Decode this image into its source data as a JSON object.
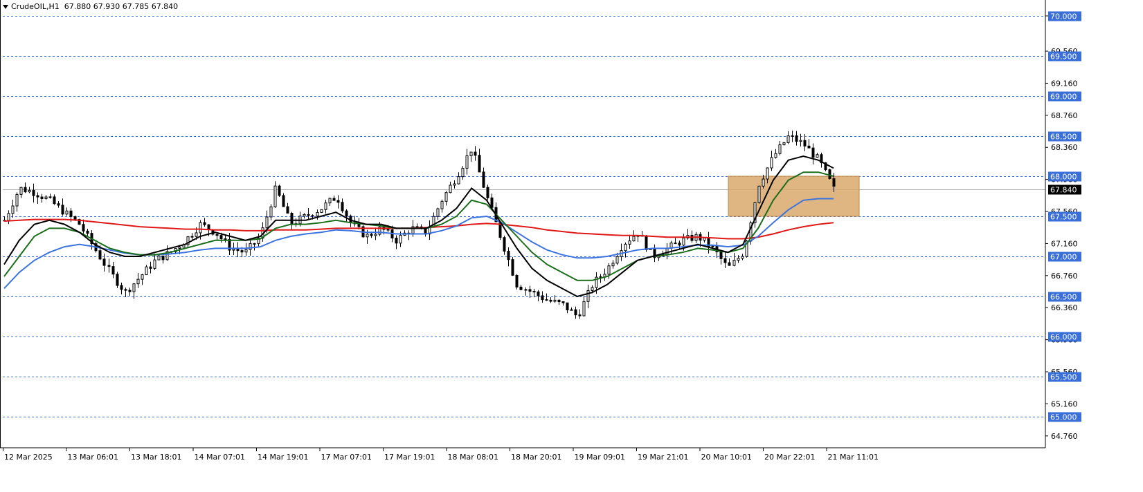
{
  "header": {
    "symbol": "CrudeOIL,H1",
    "ohlc": "67.880 67.930 67.785 67.840"
  },
  "colors": {
    "grid_level": "#3a6fd8",
    "ma_fast": "#000000",
    "ma_mid": "#1b6e1b",
    "ma_slow": "#3b74e0",
    "ma_long": "#e01818",
    "zone": "#d9a86b",
    "level_badge": "#3a6fd8",
    "price_badge": "#000000"
  },
  "chart_data": {
    "type": "candlestick",
    "timeframe": "H1",
    "ylim": [
      64.56,
      70.1
    ],
    "y_ticks": [
      "70.000",
      "69.560",
      "69.160",
      "68.760",
      "68.360",
      "67.960",
      "67.560",
      "67.160",
      "66.760",
      "66.360",
      "65.960",
      "65.560",
      "65.160",
      "64.760"
    ],
    "levels": [
      "70.000",
      "69.500",
      "69.000",
      "68.500",
      "68.000",
      "67.500",
      "67.000",
      "66.500",
      "66.000",
      "65.500",
      "65.000"
    ],
    "current_price": "67.840",
    "x_labels": [
      "12 Mar 2025",
      "13 Mar 06:01",
      "13 Mar 18:01",
      "14 Mar 07:01",
      "14 Mar 19:01",
      "17 Mar 07:01",
      "17 Mar 19:01",
      "18 Mar 08:01",
      "18 Mar 20:01",
      "19 Mar 09:01",
      "19 Mar 21:01",
      "20 Mar 10:01",
      "20 Mar 22:01",
      "21 Mar 11:01"
    ],
    "zone": {
      "from_price": 67.5,
      "to_price": 68.0
    },
    "close_path": [
      67.45,
      67.85,
      67.8,
      67.7,
      67.55,
      67.4,
      67.1,
      66.8,
      66.55,
      66.75,
      66.95,
      67.05,
      67.2,
      67.4,
      67.3,
      67.1,
      67.05,
      67.25,
      67.85,
      67.4,
      67.5,
      67.6,
      67.75,
      67.4,
      67.25,
      67.35,
      67.2,
      67.35,
      67.3,
      67.7,
      68.0,
      68.35,
      67.75,
      67.2,
      66.65,
      66.55,
      66.45,
      66.4,
      66.25,
      66.65,
      66.85,
      67.15,
      67.3,
      67.0,
      67.1,
      67.2,
      67.25,
      67.1,
      66.85,
      67.05,
      67.9,
      68.25,
      68.5,
      68.4,
      68.2,
      67.84
    ],
    "moving_averages": {
      "fast": [
        66.9,
        67.2,
        67.4,
        67.45,
        67.4,
        67.3,
        67.15,
        67.05,
        67.0,
        67.0,
        67.05,
        67.1,
        67.15,
        67.25,
        67.3,
        67.25,
        67.2,
        67.25,
        67.45,
        67.45,
        67.45,
        67.5,
        67.55,
        67.45,
        67.4,
        67.4,
        67.35,
        67.35,
        67.35,
        67.45,
        67.6,
        67.85,
        67.7,
        67.4,
        67.1,
        66.85,
        66.7,
        66.6,
        66.5,
        66.55,
        66.65,
        66.8,
        66.95,
        67.0,
        67.05,
        67.1,
        67.15,
        67.1,
        67.05,
        67.15,
        67.55,
        67.95,
        68.2,
        68.25,
        68.2,
        68.1
      ],
      "mid": [
        66.75,
        67.0,
        67.25,
        67.35,
        67.35,
        67.3,
        67.2,
        67.1,
        67.05,
        67.02,
        67.02,
        67.05,
        67.1,
        67.15,
        67.2,
        67.2,
        67.2,
        67.22,
        67.35,
        67.4,
        67.4,
        67.42,
        67.45,
        67.42,
        67.4,
        67.38,
        67.35,
        67.35,
        67.35,
        67.4,
        67.5,
        67.7,
        67.65,
        67.45,
        67.25,
        67.05,
        66.9,
        66.8,
        66.7,
        66.7,
        66.75,
        66.85,
        66.95,
        67.0,
        67.02,
        67.05,
        67.1,
        67.08,
        67.05,
        67.1,
        67.35,
        67.7,
        67.95,
        68.05,
        68.05,
        68.0
      ],
      "slow": [
        66.6,
        66.8,
        66.95,
        67.05,
        67.12,
        67.15,
        67.12,
        67.08,
        67.04,
        67.02,
        67.02,
        67.03,
        67.05,
        67.08,
        67.1,
        67.1,
        67.1,
        67.12,
        67.2,
        67.25,
        67.28,
        67.3,
        67.33,
        67.32,
        67.3,
        67.3,
        67.28,
        67.28,
        67.28,
        67.32,
        67.38,
        67.48,
        67.5,
        67.42,
        67.3,
        67.18,
        67.08,
        67.02,
        66.98,
        66.98,
        67.0,
        67.04,
        67.08,
        67.1,
        67.1,
        67.12,
        67.14,
        67.14,
        67.12,
        67.14,
        67.25,
        67.42,
        67.58,
        67.7,
        67.72,
        67.72
      ],
      "long": [
        67.44,
        67.45,
        67.46,
        67.46,
        67.46,
        67.45,
        67.43,
        67.41,
        67.39,
        67.37,
        67.36,
        67.35,
        67.34,
        67.34,
        67.33,
        67.33,
        67.32,
        67.32,
        67.33,
        67.33,
        67.33,
        67.34,
        67.35,
        67.35,
        67.35,
        67.35,
        67.35,
        67.35,
        67.36,
        67.37,
        67.38,
        67.4,
        67.41,
        67.4,
        67.38,
        67.36,
        67.33,
        67.31,
        67.29,
        67.28,
        67.27,
        67.26,
        67.26,
        67.25,
        67.24,
        67.24,
        67.24,
        67.23,
        67.22,
        67.22,
        67.24,
        67.28,
        67.33,
        67.37,
        67.4,
        67.42
      ]
    }
  }
}
